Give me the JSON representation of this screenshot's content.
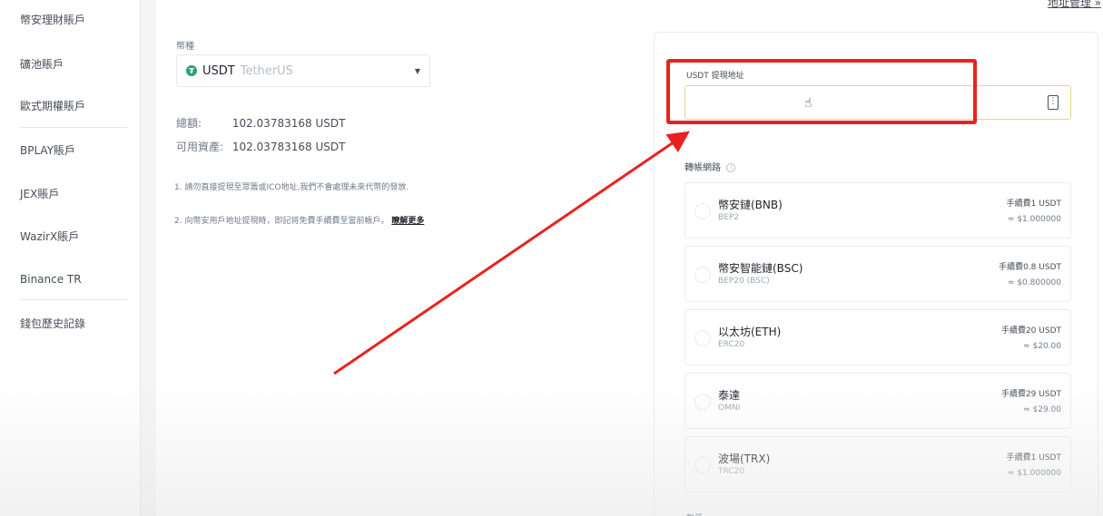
{
  "sidebar": {
    "items": [
      {
        "label": "幣安理財賬戶"
      },
      {
        "label": "礦池賬戶"
      },
      {
        "label": "歐式期權賬戶"
      },
      {
        "label": "BPLAY賬戶"
      },
      {
        "label": "JEX賬戶"
      },
      {
        "label": "WazirX賬戶"
      },
      {
        "label": "Binance TR"
      },
      {
        "label": "錢包歷史記錄"
      }
    ]
  },
  "header": {
    "address_manage_link": "地址管理 »"
  },
  "coin": {
    "label": "幣種",
    "selected_code": "USDT",
    "selected_name": "TetherUS",
    "icon": "tether-icon",
    "caret": "▼"
  },
  "balance": {
    "total_label": "總額:",
    "total_value": "102.03783168 USDT",
    "available_label": "可用資產:",
    "available_value": "102.03783168 USDT"
  },
  "notes": {
    "note1": "1. 請勿直接提現至眾籌或ICO地址,我們不會處理未來代幣的發放.",
    "note2": "2. 向幣安用戶地址提現時，即記将免費手續費至當前帳戶。",
    "note2_link": "瞭解更多"
  },
  "withdraw": {
    "address_label": "USDT 提現地址",
    "address_value": "",
    "address_placeholder": "",
    "network_label": "轉帳網路",
    "networks": [
      {
        "name": "幣安鏈(BNB)",
        "protocol": "BEP2",
        "fee": "手續費1 USDT",
        "value": "≈ $1.000000"
      },
      {
        "name": "幣安智能鏈(BSC)",
        "protocol": "BEP20 (BSC)",
        "fee": "手續費0.8 USDT",
        "value": "≈ $0.800000"
      },
      {
        "name": "以太坊(ETH)",
        "protocol": "ERC20",
        "fee": "手續費20 USDT",
        "value": "≈ $20.00"
      },
      {
        "name": "泰達",
        "protocol": "OMNI",
        "fee": "手續費29 USDT",
        "value": "≈ $29.00"
      },
      {
        "name": "波場(TRX)",
        "protocol": "TRC20",
        "fee": "手續費1 USDT",
        "value": "≈ $1.000000"
      }
    ],
    "footer_label": "數量"
  },
  "colors": {
    "highlight": "#e8231f",
    "input_focus_border": "#e9d48a",
    "tether_green": "#26a17b"
  }
}
